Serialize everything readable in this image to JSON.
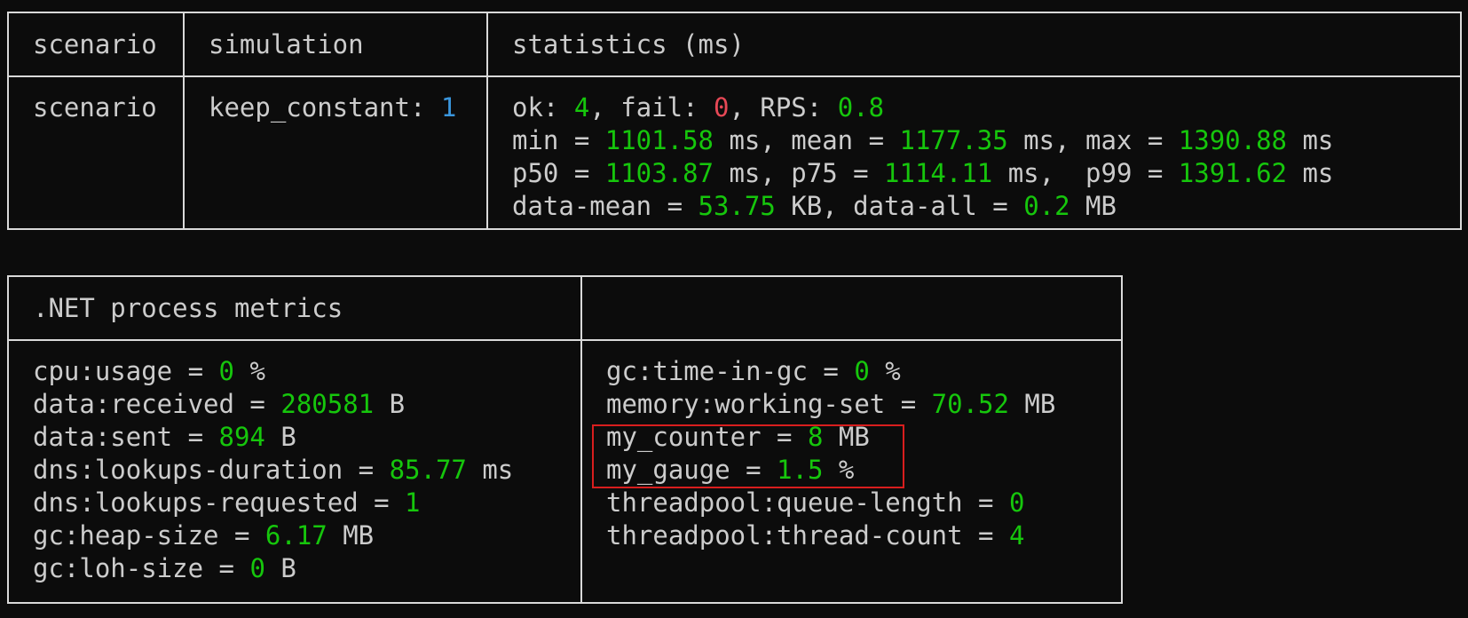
{
  "scenario_table": {
    "headers": [
      "scenario",
      "simulation",
      "statistics (ms)"
    ],
    "row": {
      "scenario": "scenario",
      "simulation": {
        "label": "keep_constant: ",
        "value": "1"
      },
      "stats": {
        "ok_label": "ok: ",
        "ok": "4",
        "fail_label": ", fail: ",
        "fail": "0",
        "rps_label": ", RPS: ",
        "rps": "0.8",
        "min_label": "min = ",
        "min": "1101.58",
        "mean_label": " ms, mean = ",
        "mean": "1177.35",
        "max_label": " ms, max = ",
        "max": "1390.88",
        "max_unit": " ms",
        "p50_label": "p50 = ",
        "p50": "1103.87",
        "p75_label": " ms, p75 = ",
        "p75": "1114.11",
        "p99_label": " ms,  p99 = ",
        "p99": "1391.62",
        "p99_unit": " ms",
        "data_mean_label": "data-mean = ",
        "data_mean": "53.75",
        "data_mean_unit": " KB",
        "data_all_label": ", data-all = ",
        "data_all": "0.2",
        "data_all_unit": " MB"
      }
    }
  },
  "metrics_table": {
    "header_left": ".NET process metrics",
    "header_right": "",
    "left": [
      {
        "label": "cpu:usage = ",
        "value": "0",
        "unit": " %"
      },
      {
        "label": "data:received = ",
        "value": "280581",
        "unit": " B"
      },
      {
        "label": "data:sent = ",
        "value": "894",
        "unit": " B"
      },
      {
        "label": "dns:lookups-duration = ",
        "value": "85.77",
        "unit": " ms"
      },
      {
        "label": "dns:lookups-requested = ",
        "value": "1",
        "unit": ""
      },
      {
        "label": "gc:heap-size = ",
        "value": "6.17",
        "unit": " MB"
      },
      {
        "label": "gc:loh-size = ",
        "value": "0",
        "unit": " B"
      }
    ],
    "right": [
      {
        "label": "gc:time-in-gc = ",
        "value": "0",
        "unit": " %"
      },
      {
        "label": "memory:working-set = ",
        "value": "70.52",
        "unit": " MB"
      },
      {
        "label": "my_counter = ",
        "value": "8",
        "unit": " MB"
      },
      {
        "label": "my_gauge = ",
        "value": "1.5",
        "unit": " %"
      },
      {
        "label": "threadpool:queue-length = ",
        "value": "0",
        "unit": ""
      },
      {
        "label": "threadpool:thread-count = ",
        "value": "4",
        "unit": ""
      }
    ]
  },
  "colors": {
    "background": "#0c0c0c",
    "text": "#cccccc",
    "number": "#16c60c",
    "count_value": "#3a96dd",
    "fail_value": "#e74856",
    "highlight_border": "#d81e1e"
  }
}
